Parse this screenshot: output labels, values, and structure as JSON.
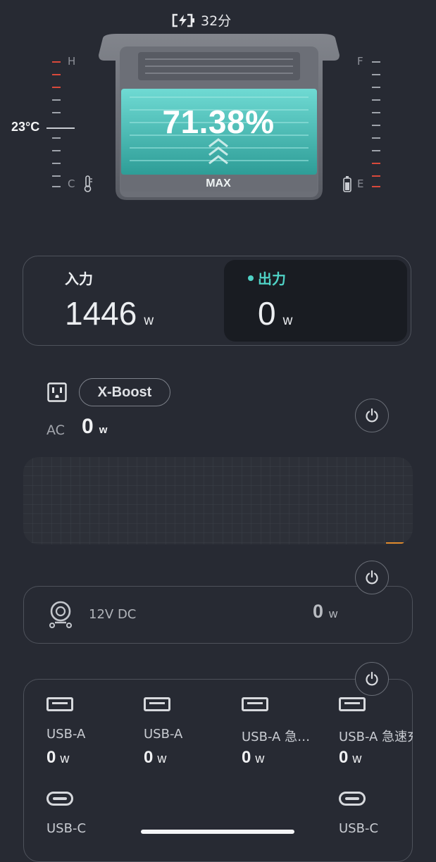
{
  "status": {
    "icon": "battery-charging-icon",
    "remaining_time": "32分"
  },
  "gauge_left": {
    "high_label": "H",
    "low_label": "C",
    "temperature": "23°C",
    "icon": "thermometer-icon"
  },
  "gauge_right": {
    "full_label": "F",
    "empty_label": "E",
    "icon": "battery-icon"
  },
  "battery": {
    "percent": "71.38%",
    "percent_value": 71.38,
    "charge_mode": "MAX",
    "accent_color": "#46c6c0"
  },
  "io": {
    "input_label": "入力",
    "input_value": "1446",
    "input_unit": "w",
    "output_label": "出力",
    "output_value": "0",
    "output_unit": "w",
    "active_color": "#4fd1c5"
  },
  "ac": {
    "icon": "ac-outlet-icon",
    "xboost_label": "X-Boost",
    "label": "AC",
    "value": "0",
    "unit": "w",
    "power_icon": "power-icon"
  },
  "dc": {
    "icon": "car-outlet-icon",
    "label": "12V DC",
    "value": "0",
    "unit": "w",
    "power_icon": "power-icon"
  },
  "usb": {
    "power_icon": "power-icon",
    "ports": [
      {
        "type": "usb-a-icon",
        "name": "USB-A",
        "value": "0",
        "unit": "w"
      },
      {
        "type": "usb-a-icon",
        "name": "USB-A",
        "value": "0",
        "unit": "w"
      },
      {
        "type": "usb-a-icon",
        "name": "USB-A 急…",
        "value": "0",
        "unit": "w"
      },
      {
        "type": "usb-a-icon",
        "name": "USB-A 急速充",
        "value": "0",
        "unit": "w"
      },
      {
        "type": "usb-c-icon",
        "name": "USB-C",
        "value": "0",
        "unit": "w"
      },
      {
        "type": "usb-c-icon",
        "name": "USB-C",
        "value": "0",
        "unit": "w"
      }
    ]
  }
}
